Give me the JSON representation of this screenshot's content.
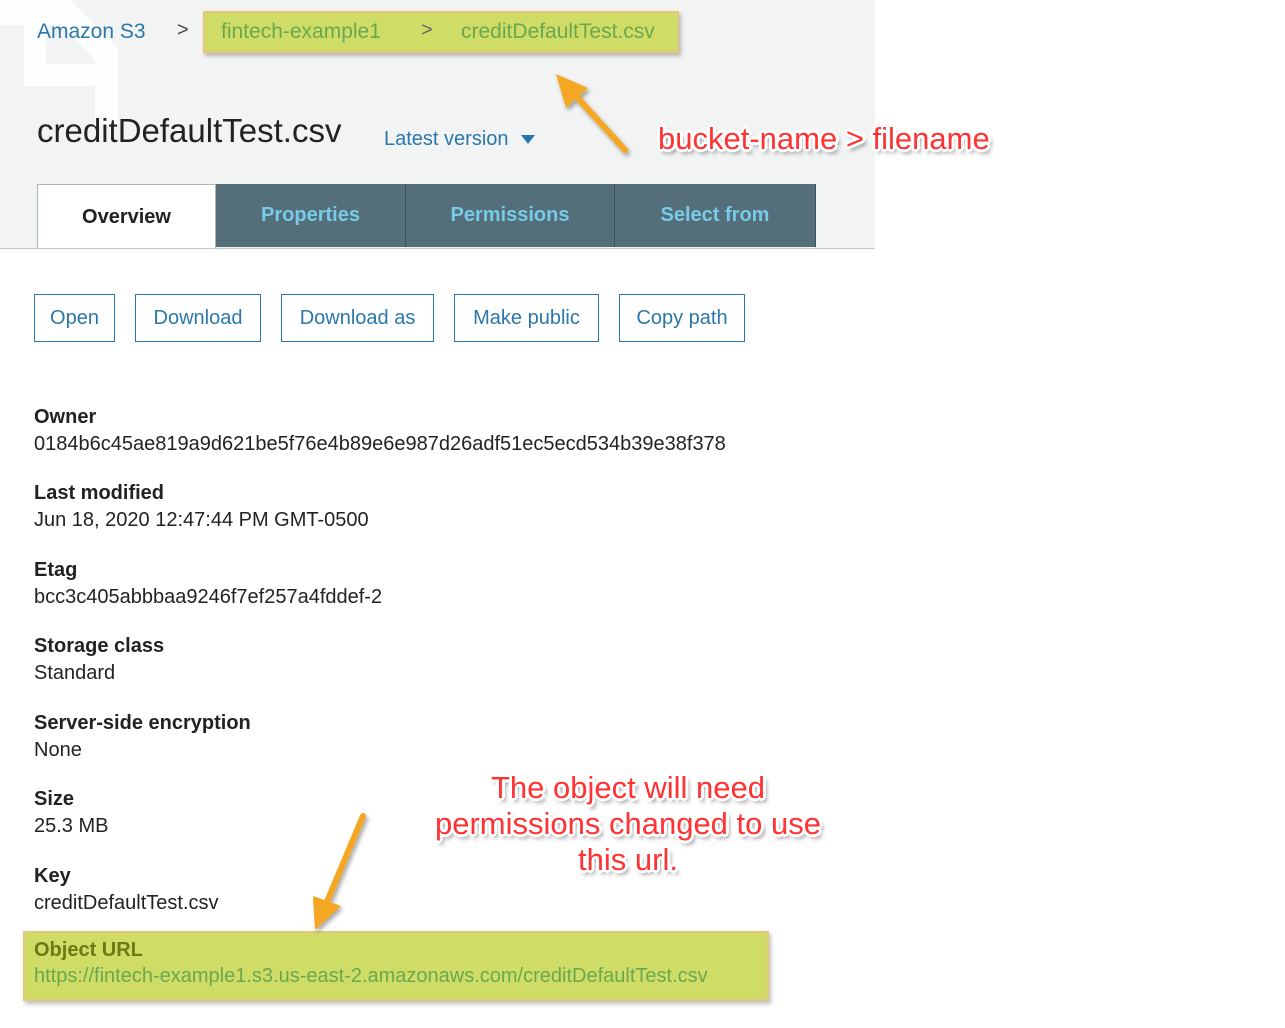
{
  "breadcrumb": {
    "root": "Amazon S3",
    "separator": ">",
    "bucket": "fintech-example1",
    "file": "creditDefaultTest.csv"
  },
  "header": {
    "title": "creditDefaultTest.csv",
    "version_label": "Latest version"
  },
  "tabs": [
    {
      "label": "Overview",
      "active": true
    },
    {
      "label": "Properties",
      "active": false
    },
    {
      "label": "Permissions",
      "active": false
    },
    {
      "label": "Select from",
      "active": false
    }
  ],
  "actions": [
    {
      "label": "Open"
    },
    {
      "label": "Download"
    },
    {
      "label": "Download as"
    },
    {
      "label": "Make public"
    },
    {
      "label": "Copy path"
    }
  ],
  "details": [
    {
      "label": "Owner",
      "value": "0184b6c45ae819a9d621be5f76e4b89e6e987d26adf51ec5ecd534b39e38f378"
    },
    {
      "label": "Last modified",
      "value": "Jun 18, 2020 12:47:44 PM GMT-0500"
    },
    {
      "label": "Etag",
      "value": "bcc3c405abbbaa9246f7ef257a4fddef-2"
    },
    {
      "label": "Storage class",
      "value": "Standard"
    },
    {
      "label": "Server-side encryption",
      "value": "None"
    },
    {
      "label": "Size",
      "value": "25.3 MB"
    },
    {
      "label": "Key",
      "value": "creditDefaultTest.csv"
    }
  ],
  "object_url": {
    "label": "Object URL",
    "value": "https://fintech-example1.s3.us-east-2.amazonaws.com/creditDefaultTest.csv"
  },
  "annotations": {
    "top": "bucket-name > filename",
    "bottom_line1": "The object will need",
    "bottom_line2": "permissions changed to use",
    "bottom_line3": "this url."
  },
  "colors": {
    "link_blue": "#2b77ab",
    "tab_dark": "#546e7a",
    "tab_text": "#78cbe8",
    "highlight": "#cfdd67",
    "annotation_red": "#ff3333",
    "arrow_orange": "#f5a623"
  }
}
